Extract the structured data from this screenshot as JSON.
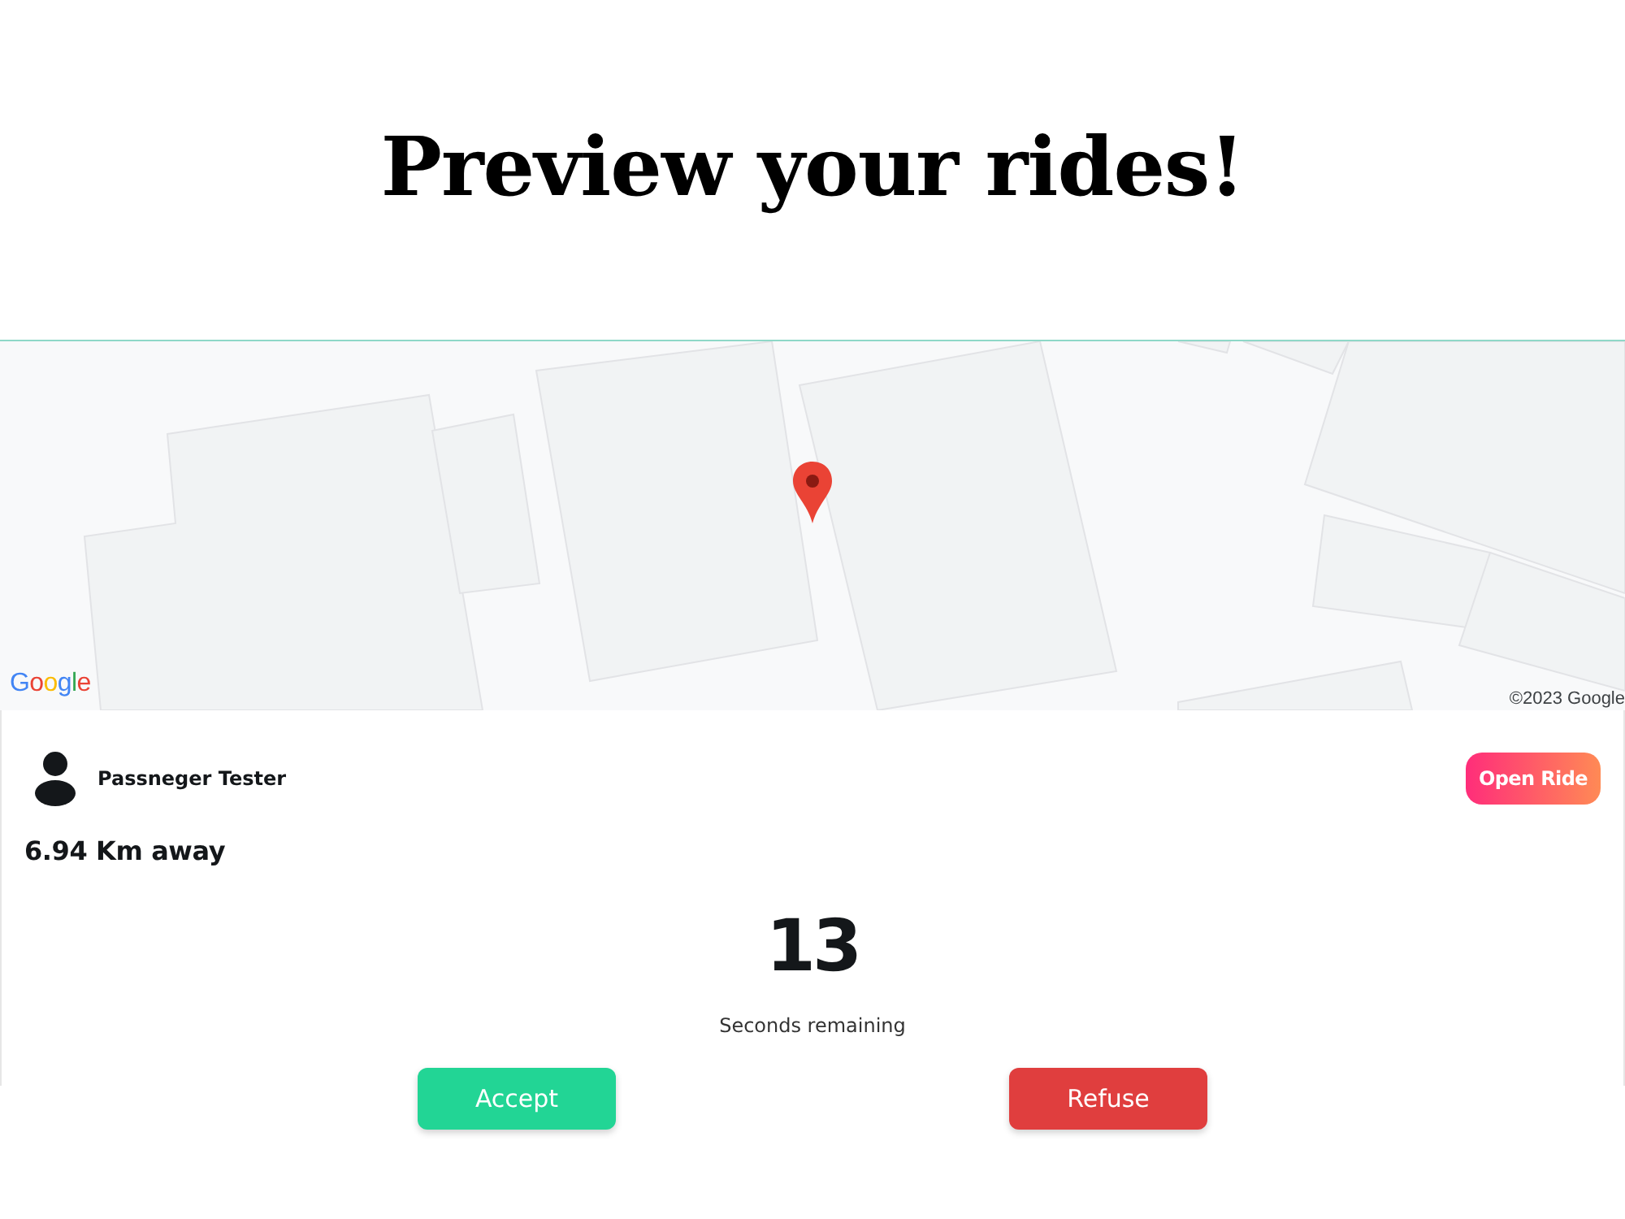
{
  "title": "Preview your rides!",
  "map": {
    "logo": "Google",
    "attribution": "©2023 Google"
  },
  "ride": {
    "passenger": "Passneger Tester",
    "open_button": "Open Ride",
    "distance": "6.94 Km away",
    "countdown": "13",
    "countdown_label": "Seconds remaining"
  },
  "actions": [
    {
      "kind": "accept",
      "label": "Accept"
    },
    {
      "kind": "refuse",
      "label": "Refuse"
    }
  ]
}
